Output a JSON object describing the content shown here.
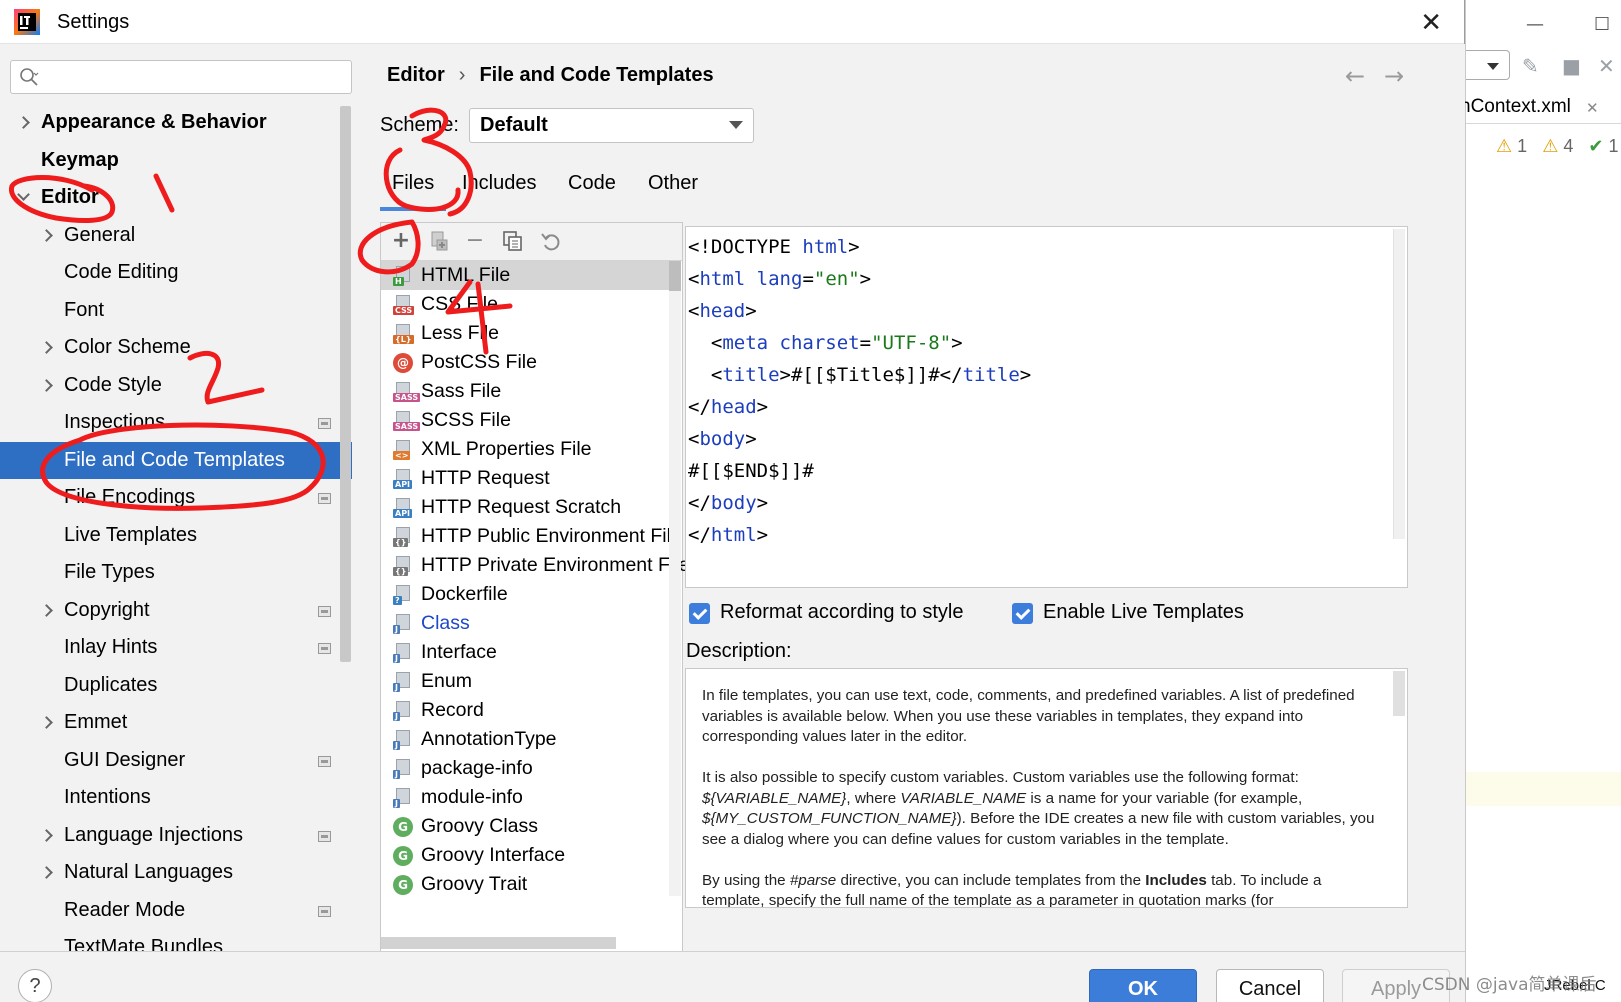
{
  "window": {
    "title": "Settings"
  },
  "search": {
    "placeholder": ""
  },
  "tree": [
    {
      "label": "Appearance & Behavior",
      "indent": 0,
      "expander": "right",
      "bold": true,
      "project": false,
      "selected": false
    },
    {
      "label": "Keymap",
      "indent": 0,
      "expander": "",
      "bold": true,
      "project": false,
      "selected": false
    },
    {
      "label": "Editor",
      "indent": 0,
      "expander": "down",
      "bold": true,
      "project": false,
      "selected": false
    },
    {
      "label": "General",
      "indent": 1,
      "expander": "right",
      "bold": false,
      "project": false,
      "selected": false
    },
    {
      "label": "Code Editing",
      "indent": 1,
      "expander": "",
      "bold": false,
      "project": false,
      "selected": false
    },
    {
      "label": "Font",
      "indent": 1,
      "expander": "",
      "bold": false,
      "project": false,
      "selected": false
    },
    {
      "label": "Color Scheme",
      "indent": 1,
      "expander": "right",
      "bold": false,
      "project": false,
      "selected": false
    },
    {
      "label": "Code Style",
      "indent": 1,
      "expander": "right",
      "bold": false,
      "project": false,
      "selected": false
    },
    {
      "label": "Inspections",
      "indent": 1,
      "expander": "",
      "bold": false,
      "project": true,
      "selected": false
    },
    {
      "label": "File and Code Templates",
      "indent": 1,
      "expander": "",
      "bold": false,
      "project": false,
      "selected": true
    },
    {
      "label": "File Encodings",
      "indent": 1,
      "expander": "",
      "bold": false,
      "project": true,
      "selected": false
    },
    {
      "label": "Live Templates",
      "indent": 1,
      "expander": "",
      "bold": false,
      "project": false,
      "selected": false
    },
    {
      "label": "File Types",
      "indent": 1,
      "expander": "",
      "bold": false,
      "project": false,
      "selected": false
    },
    {
      "label": "Copyright",
      "indent": 1,
      "expander": "right",
      "bold": false,
      "project": true,
      "selected": false
    },
    {
      "label": "Inlay Hints",
      "indent": 1,
      "expander": "",
      "bold": false,
      "project": true,
      "selected": false
    },
    {
      "label": "Duplicates",
      "indent": 1,
      "expander": "",
      "bold": false,
      "project": false,
      "selected": false
    },
    {
      "label": "Emmet",
      "indent": 1,
      "expander": "right",
      "bold": false,
      "project": false,
      "selected": false
    },
    {
      "label": "GUI Designer",
      "indent": 1,
      "expander": "",
      "bold": false,
      "project": true,
      "selected": false
    },
    {
      "label": "Intentions",
      "indent": 1,
      "expander": "",
      "bold": false,
      "project": false,
      "selected": false
    },
    {
      "label": "Language Injections",
      "indent": 1,
      "expander": "right",
      "bold": false,
      "project": true,
      "selected": false
    },
    {
      "label": "Natural Languages",
      "indent": 1,
      "expander": "right",
      "bold": false,
      "project": false,
      "selected": false
    },
    {
      "label": "Reader Mode",
      "indent": 1,
      "expander": "",
      "bold": false,
      "project": true,
      "selected": false
    },
    {
      "label": "TextMate Bundles",
      "indent": 1,
      "expander": "",
      "bold": false,
      "project": false,
      "selected": false
    }
  ],
  "breadcrumb": {
    "parent": "Editor",
    "sep": "›",
    "current": "File and Code Templates"
  },
  "nav": {
    "back": "←",
    "forward": "→"
  },
  "scheme": {
    "label": "Scheme:",
    "value": "Default"
  },
  "tabs": [
    "Files",
    "Includes",
    "Code",
    "Other"
  ],
  "active_tab": "Files",
  "toolbar": {
    "add": "+",
    "copy_icon": "copy-icon",
    "remove": "−",
    "duplicate_icon": "duplicate-icon",
    "reset_icon": "reset-icon"
  },
  "templates": [
    {
      "name": "HTML File",
      "icon": "html-file-icon",
      "tag": "H",
      "color": "#3c9b3c",
      "selected": true
    },
    {
      "name": "CSS File",
      "icon": "css-file-icon",
      "tag": "CSS",
      "color": "#d0423a",
      "selected": false
    },
    {
      "name": "Less File",
      "icon": "less-file-icon",
      "tag": "{L}",
      "color": "#d66b2a",
      "selected": false
    },
    {
      "name": "PostCSS File",
      "icon": "postcss-file-icon",
      "tag": "@",
      "color": "#dd4b39",
      "round": true,
      "selected": false
    },
    {
      "name": "Sass File",
      "icon": "sass-file-icon",
      "tag": "SASS",
      "color": "#c6538c",
      "selected": false
    },
    {
      "name": "SCSS File",
      "icon": "scss-file-icon",
      "tag": "SASS",
      "color": "#c6538c",
      "selected": false
    },
    {
      "name": "XML Properties File",
      "icon": "xml-file-icon",
      "tag": "<>",
      "color": "#e07a2e",
      "selected": false
    },
    {
      "name": "HTTP Request",
      "icon": "http-request-icon",
      "tag": "API",
      "color": "#3a7fc1",
      "selected": false
    },
    {
      "name": "HTTP Request Scratch",
      "icon": "http-scratch-icon",
      "tag": "API",
      "color": "#3a7fc1",
      "selected": false
    },
    {
      "name": "HTTP Public Environment File",
      "icon": "env-file-icon",
      "tag": "{}",
      "color": "#777777",
      "selected": false
    },
    {
      "name": "HTTP Private Environment File",
      "icon": "env-file-icon",
      "tag": "{}",
      "color": "#777777",
      "selected": false
    },
    {
      "name": "Dockerfile",
      "icon": "dockerfile-icon",
      "tag": "?",
      "color": "#3a7fc1",
      "selected": false
    },
    {
      "name": "Class",
      "icon": "java-class-icon",
      "tag": "J",
      "color": "#4a7ab8",
      "selected": false,
      "blue": true
    },
    {
      "name": "Interface",
      "icon": "java-interface-icon",
      "tag": "J",
      "color": "#4a7ab8",
      "selected": false
    },
    {
      "name": "Enum",
      "icon": "java-enum-icon",
      "tag": "J",
      "color": "#4a7ab8",
      "selected": false
    },
    {
      "name": "Record",
      "icon": "java-record-icon",
      "tag": "J",
      "color": "#4a7ab8",
      "selected": false
    },
    {
      "name": "AnnotationType",
      "icon": "java-annotation-icon",
      "tag": "J",
      "color": "#4a7ab8",
      "selected": false
    },
    {
      "name": "package-info",
      "icon": "java-package-info-icon",
      "tag": "J",
      "color": "#4a7ab8",
      "selected": false
    },
    {
      "name": "module-info",
      "icon": "java-module-info-icon",
      "tag": "J",
      "color": "#4a7ab8",
      "selected": false
    },
    {
      "name": "Groovy Class",
      "icon": "groovy-class-icon",
      "tag": "G",
      "color": "#5fae5f",
      "round": true,
      "selected": false
    },
    {
      "name": "Groovy Interface",
      "icon": "groovy-interface-icon",
      "tag": "G",
      "color": "#5fae5f",
      "round": true,
      "selected": false
    },
    {
      "name": "Groovy Trait",
      "icon": "groovy-trait-icon",
      "tag": "G",
      "color": "#5fae5f",
      "round": true,
      "selected": false
    }
  ],
  "code_lines": [
    [
      {
        "t": "<!DOCTYPE ",
        "c": ""
      },
      {
        "t": "html",
        "c": "kw"
      },
      {
        "t": ">",
        "c": ""
      }
    ],
    [
      {
        "t": "<",
        "c": ""
      },
      {
        "t": "html",
        "c": "kw"
      },
      {
        "t": " ",
        "c": ""
      },
      {
        "t": "lang",
        "c": "kw"
      },
      {
        "t": "=",
        "c": ""
      },
      {
        "t": "\"en\"",
        "c": "str"
      },
      {
        "t": ">",
        "c": ""
      }
    ],
    [
      {
        "t": "<",
        "c": ""
      },
      {
        "t": "head",
        "c": "kw"
      },
      {
        "t": ">",
        "c": ""
      }
    ],
    [
      {
        "t": "  <",
        "c": ""
      },
      {
        "t": "meta",
        "c": "kw"
      },
      {
        "t": " ",
        "c": ""
      },
      {
        "t": "charset",
        "c": "kw"
      },
      {
        "t": "=",
        "c": ""
      },
      {
        "t": "\"UTF-8\"",
        "c": "str"
      },
      {
        "t": ">",
        "c": ""
      }
    ],
    [
      {
        "t": "  <",
        "c": ""
      },
      {
        "t": "title",
        "c": "kw"
      },
      {
        "t": ">#[[$Title$]]#</",
        "c": ""
      },
      {
        "t": "title",
        "c": "kw"
      },
      {
        "t": ">",
        "c": ""
      }
    ],
    [
      {
        "t": "</",
        "c": ""
      },
      {
        "t": "head",
        "c": "kw"
      },
      {
        "t": ">",
        "c": ""
      }
    ],
    [
      {
        "t": "<",
        "c": ""
      },
      {
        "t": "body",
        "c": "kw"
      },
      {
        "t": ">",
        "c": ""
      }
    ],
    [
      {
        "t": "#[[$END$]]#",
        "c": ""
      }
    ],
    [
      {
        "t": "</",
        "c": ""
      },
      {
        "t": "body",
        "c": "kw"
      },
      {
        "t": ">",
        "c": ""
      }
    ],
    [
      {
        "t": "</",
        "c": ""
      },
      {
        "t": "html",
        "c": "kw"
      },
      {
        "t": ">",
        "c": ""
      }
    ]
  ],
  "options": {
    "reformat": {
      "label": "Reformat according to style",
      "checked": true
    },
    "live_templates": {
      "label": "Enable Live Templates",
      "checked": true
    }
  },
  "description": {
    "label": "Description:",
    "paragraphs": [
      [
        {
          "t": "In file templates, you can use text, code, comments, and predefined variables. A list of predefined variables is available below. When you use these variables in templates, they expand into corresponding values later in the editor.",
          "s": ""
        }
      ],
      [
        {
          "t": "It is also possible to specify custom variables. Custom variables use the following format: ",
          "s": ""
        },
        {
          "t": "${VARIABLE_NAME}",
          "s": "i"
        },
        {
          "t": ", where ",
          "s": ""
        },
        {
          "t": "VARIABLE_NAME",
          "s": "i"
        },
        {
          "t": " is a name for your variable (for example, ",
          "s": ""
        },
        {
          "t": "${MY_CUSTOM_FUNCTION_NAME}",
          "s": "i"
        },
        {
          "t": "). Before the IDE creates a new file with custom variables, you see a dialog where you can define values for custom variables in the template.",
          "s": ""
        }
      ],
      [
        {
          "t": "By using the ",
          "s": ""
        },
        {
          "t": "#parse",
          "s": "i"
        },
        {
          "t": " directive, you can include templates from the ",
          "s": ""
        },
        {
          "t": "Includes",
          "s": "b"
        },
        {
          "t": " tab. To include a template, specify the full name of the template as a parameter in quotation marks (for",
          "s": ""
        }
      ]
    ]
  },
  "buttons": {
    "help": "?",
    "ok": "OK",
    "cancel": "Cancel",
    "apply": "Apply"
  },
  "background_ide": {
    "minimize": "—",
    "maximize": "☐",
    "tab_label": "nContext.xml",
    "tab_close": "✕",
    "inspection_warn1": "1",
    "inspection_warn2": "4",
    "inspection_ok": "1",
    "jrebel": "JRebel C"
  },
  "annotations": {
    "n1": "1",
    "n2": "2",
    "n3": "3",
    "n4": "4",
    "color": "#ee1c1c"
  },
  "watermark": "CSDN @java简单课后"
}
